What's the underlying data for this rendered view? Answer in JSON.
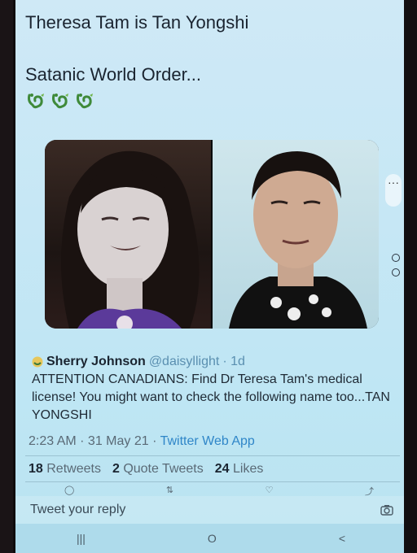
{
  "tweet": {
    "line1": "Theresa Tam is Tan Yongshi",
    "line2": "Satanic World Order...",
    "emojis": [
      "dragon-emoji",
      "dragon-emoji",
      "dragon-emoji"
    ]
  },
  "quote": {
    "display_name": "Sherry Johnson",
    "handle": "@daisyllight",
    "age": "· 1d",
    "body": "ATTENTION CANADIANS: Find Dr Teresa Tam's medical license! You might want to check the following name too...TAN YONGSHI"
  },
  "meta": {
    "time": "2:23 AM",
    "date": "· 31 May 21 ·",
    "source": "Twitter Web App"
  },
  "stats": {
    "retweets_count": "18",
    "retweets_label": "Retweets",
    "quotes_count": "2",
    "quotes_label": "Quote Tweets",
    "likes_count": "24",
    "likes_label": "Likes"
  },
  "reply": {
    "placeholder": "Tweet your reply"
  },
  "nav": {
    "recents": "|||",
    "home": "O",
    "back": "<"
  },
  "colors": {
    "accent": "#2f86c8",
    "background": "#c6e7f5"
  }
}
